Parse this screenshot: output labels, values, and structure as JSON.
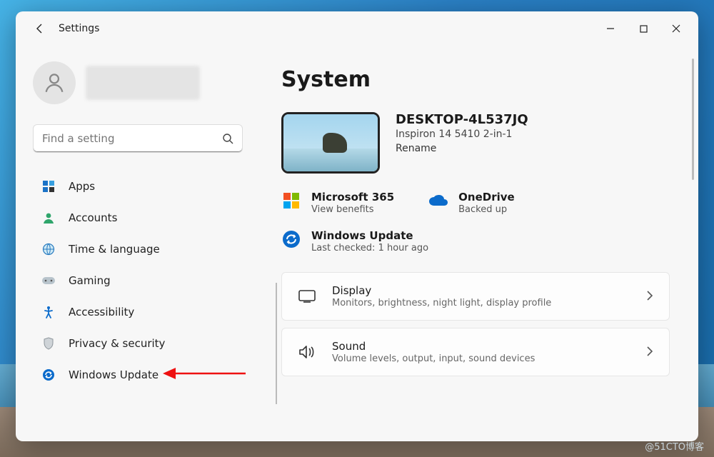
{
  "window": {
    "title": "Settings"
  },
  "search": {
    "placeholder": "Find a setting"
  },
  "sidebar": {
    "items": [
      {
        "label": "Apps"
      },
      {
        "label": "Accounts"
      },
      {
        "label": "Time & language"
      },
      {
        "label": "Gaming"
      },
      {
        "label": "Accessibility"
      },
      {
        "label": "Privacy & security"
      },
      {
        "label": "Windows Update"
      }
    ]
  },
  "page": {
    "heading": "System",
    "device": {
      "name": "DESKTOP-4L537JQ",
      "model": "Inspiron 14 5410 2-in-1",
      "rename": "Rename"
    },
    "tiles": {
      "m365": {
        "title": "Microsoft 365",
        "sub": "View benefits"
      },
      "onedrive": {
        "title": "OneDrive",
        "sub": "Backed up"
      },
      "wu": {
        "title": "Windows Update",
        "sub": "Last checked: 1 hour ago"
      }
    },
    "cards": [
      {
        "title": "Display",
        "sub": "Monitors, brightness, night light, display profile"
      },
      {
        "title": "Sound",
        "sub": "Volume levels, output, input, sound devices"
      }
    ]
  },
  "watermark": "@51CTO博客"
}
